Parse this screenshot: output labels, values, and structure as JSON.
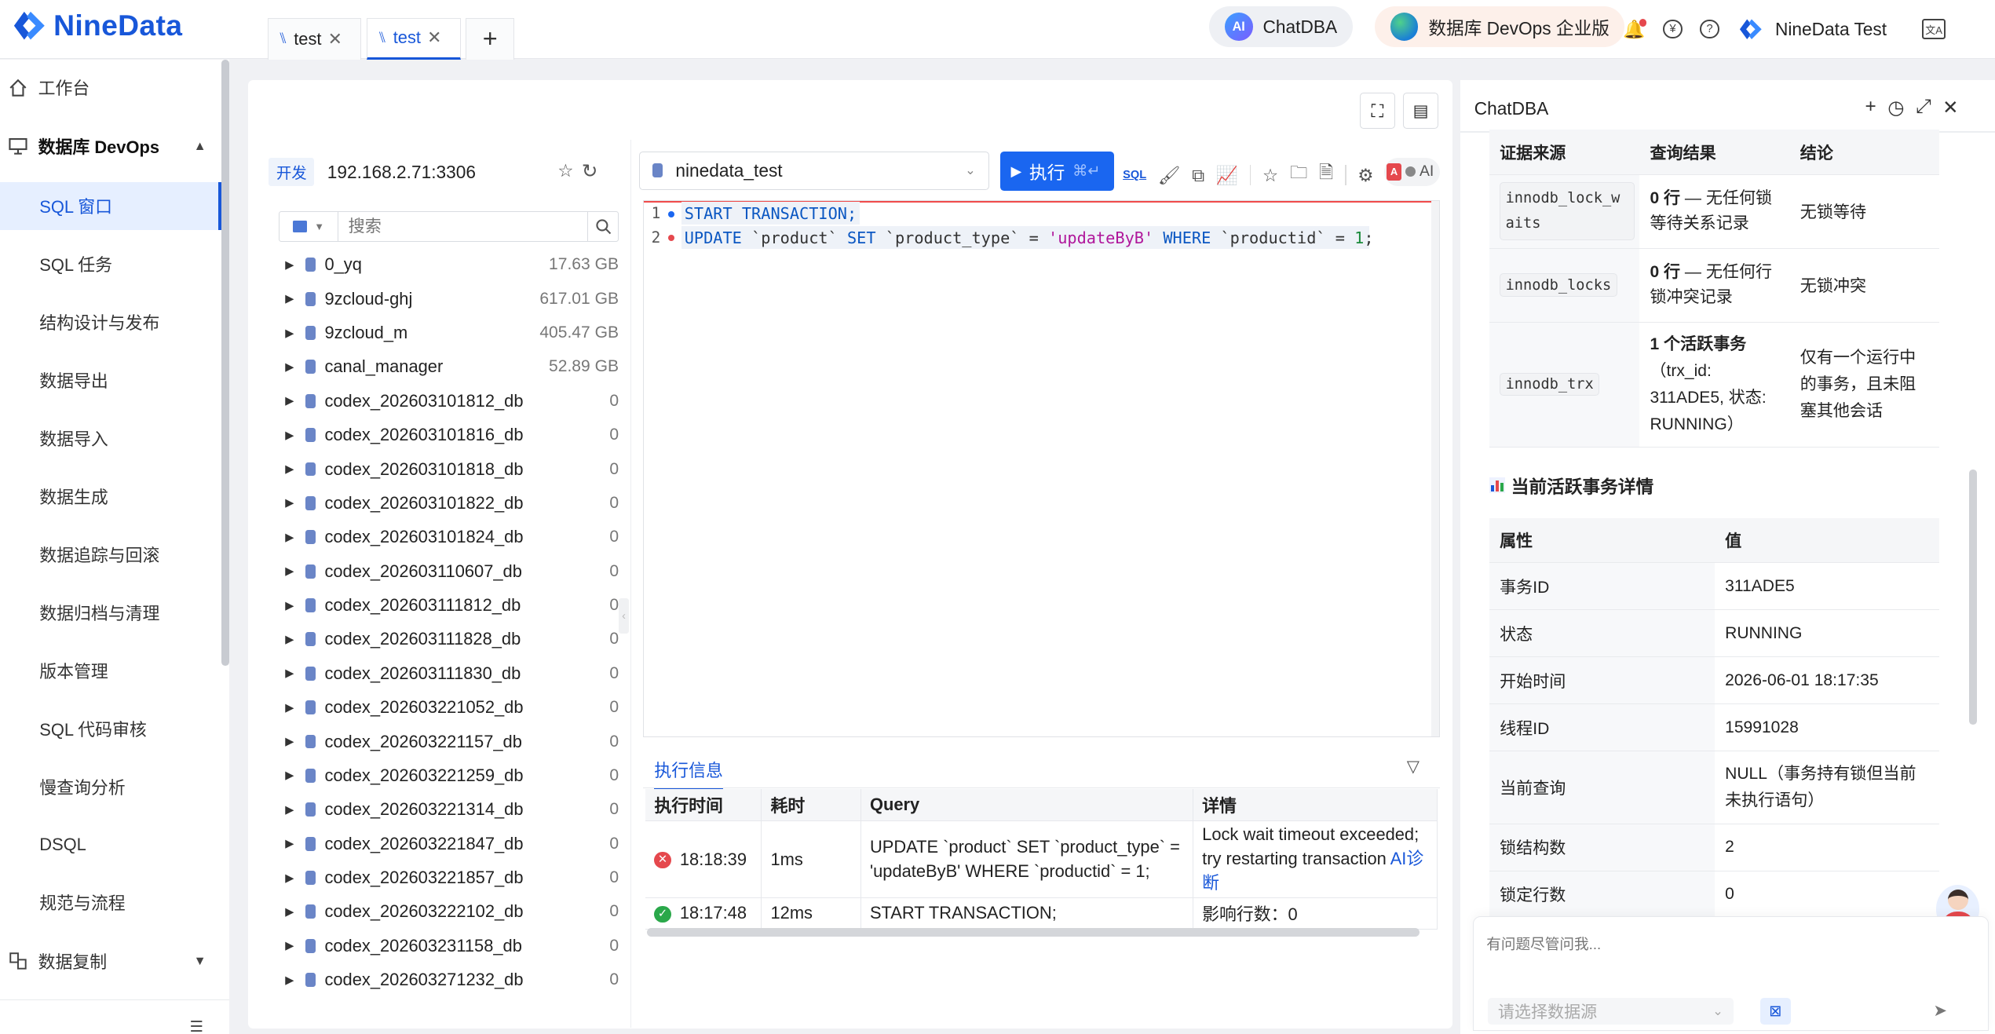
{
  "header": {
    "brand": "NineData",
    "chatdba_label": "ChatDBA",
    "chatdba_badge": "AI",
    "devops_label": "数据库 DevOps 企业版",
    "user_label": "NineData Test"
  },
  "sidebar": {
    "workbench": "工作台",
    "devops_group": "数据库 DevOps",
    "items": [
      "SQL 窗口",
      "SQL 任务",
      "结构设计与发布",
      "数据导出",
      "数据导入",
      "数据生成",
      "数据追踪与回滚",
      "数据归档与清理",
      "版本管理",
      "SQL 代码审核",
      "慢查询分析",
      "DSQL",
      "规范与流程"
    ],
    "replication_group": "数据复制"
  },
  "tabs": [
    {
      "label": "test"
    },
    {
      "label": "test"
    }
  ],
  "connection": {
    "env_badge": "开发",
    "address": "192.168.2.71:3306"
  },
  "tree": {
    "search_placeholder": "搜索",
    "databases": [
      {
        "name": "0_yq",
        "size": "17.63 GB"
      },
      {
        "name": "9zcloud-ghj",
        "size": "617.01 GB"
      },
      {
        "name": "9zcloud_m",
        "size": "405.47 GB"
      },
      {
        "name": "canal_manager",
        "size": "52.89 GB"
      },
      {
        "name": "codex_202603101812_db",
        "size": "0"
      },
      {
        "name": "codex_202603101816_db",
        "size": "0"
      },
      {
        "name": "codex_202603101818_db",
        "size": "0"
      },
      {
        "name": "codex_202603101822_db",
        "size": "0"
      },
      {
        "name": "codex_202603101824_db",
        "size": "0"
      },
      {
        "name": "codex_202603110607_db",
        "size": "0"
      },
      {
        "name": "codex_202603111812_db",
        "size": "0"
      },
      {
        "name": "codex_202603111828_db",
        "size": "0"
      },
      {
        "name": "codex_202603111830_db",
        "size": "0"
      },
      {
        "name": "codex_202603221052_db",
        "size": "0"
      },
      {
        "name": "codex_202603221157_db",
        "size": "0"
      },
      {
        "name": "codex_202603221259_db",
        "size": "0"
      },
      {
        "name": "codex_202603221314_db",
        "size": "0"
      },
      {
        "name": "codex_202603221847_db",
        "size": "0"
      },
      {
        "name": "codex_202603221857_db",
        "size": "0"
      },
      {
        "name": "codex_202603222102_db",
        "size": "0"
      },
      {
        "name": "codex_202603231158_db",
        "size": "0"
      },
      {
        "name": "codex_202603271232_db",
        "size": "0"
      }
    ]
  },
  "toolbar": {
    "database": "ninedata_test",
    "execute_label": "执行",
    "execute_shortcut": "⌘↵",
    "sql_icon_text": "SQL",
    "ai_label": "AI"
  },
  "editor": {
    "line_numbers": [
      "1",
      "2"
    ],
    "line1": "START TRANSACTION;",
    "line2_parts": [
      "UPDATE ",
      "`product`",
      " SET ",
      "`product_type`",
      " = ",
      "'updateByB'",
      " WHERE ",
      "`productid`",
      " = ",
      "1",
      ";"
    ]
  },
  "results": {
    "tab_label": "执行信息",
    "columns": [
      "执行时间",
      "耗时",
      "Query",
      "详情"
    ],
    "rows": [
      {
        "status": "error",
        "time": "18:18:39",
        "duration": "1ms",
        "query": "UPDATE `product` SET `product_type` = 'updateByB' WHERE `productid` = 1;",
        "detail": "Lock wait timeout exceeded; try restarting transaction",
        "link_a": "AI",
        "link_b": "诊断"
      },
      {
        "status": "success",
        "time": "18:17:48",
        "duration": "12ms",
        "query": "START TRANSACTION;",
        "detail": "影响行数：0"
      }
    ]
  },
  "chat": {
    "title": "ChatDBA",
    "evidence": {
      "columns": [
        "证据来源",
        "查询结果",
        "结论"
      ],
      "rows": [
        {
          "source": "innodb_lock_waits",
          "result_bold": "0 行",
          "result_rest": " — 无任何锁等待关系记录",
          "conclusion": "无锁等待"
        },
        {
          "source": "innodb_locks",
          "result_bold": "0 行",
          "result_rest": " — 无任何行锁冲突记录",
          "conclusion": "无锁冲突"
        },
        {
          "source": "innodb_trx",
          "result_bold": "1 个活跃事务",
          "result_rest": "（trx_id: 311ADE5, 状态: RUNNING）",
          "conclusion": "仅有一个运行中的事务，且未阻塞其他会话"
        }
      ]
    },
    "section_title": "当前活跃事务详情",
    "details": {
      "columns": [
        "属性",
        "值"
      ],
      "rows": [
        {
          "k": "事务ID",
          "v": "311ADE5"
        },
        {
          "k": "状态",
          "v": "RUNNING"
        },
        {
          "k": "开始时间",
          "v": "2026-06-01 18:17:35"
        },
        {
          "k": "线程ID",
          "v": "15991028"
        },
        {
          "k": "当前查询",
          "v": "NULL（事务持有锁但当前未执行语句）"
        },
        {
          "k": "锁结构数",
          "v": "2"
        },
        {
          "k": "锁定行数",
          "v": "0"
        }
      ]
    },
    "input_placeholder": "有问题尽管问我...",
    "datasource_placeholder": "请选择数据源"
  },
  "colors": {
    "brand": "#1857d9",
    "error": "#e5484d",
    "success": "#2aa84a",
    "keyword": "#0b57c2",
    "string": "#b0179b"
  }
}
